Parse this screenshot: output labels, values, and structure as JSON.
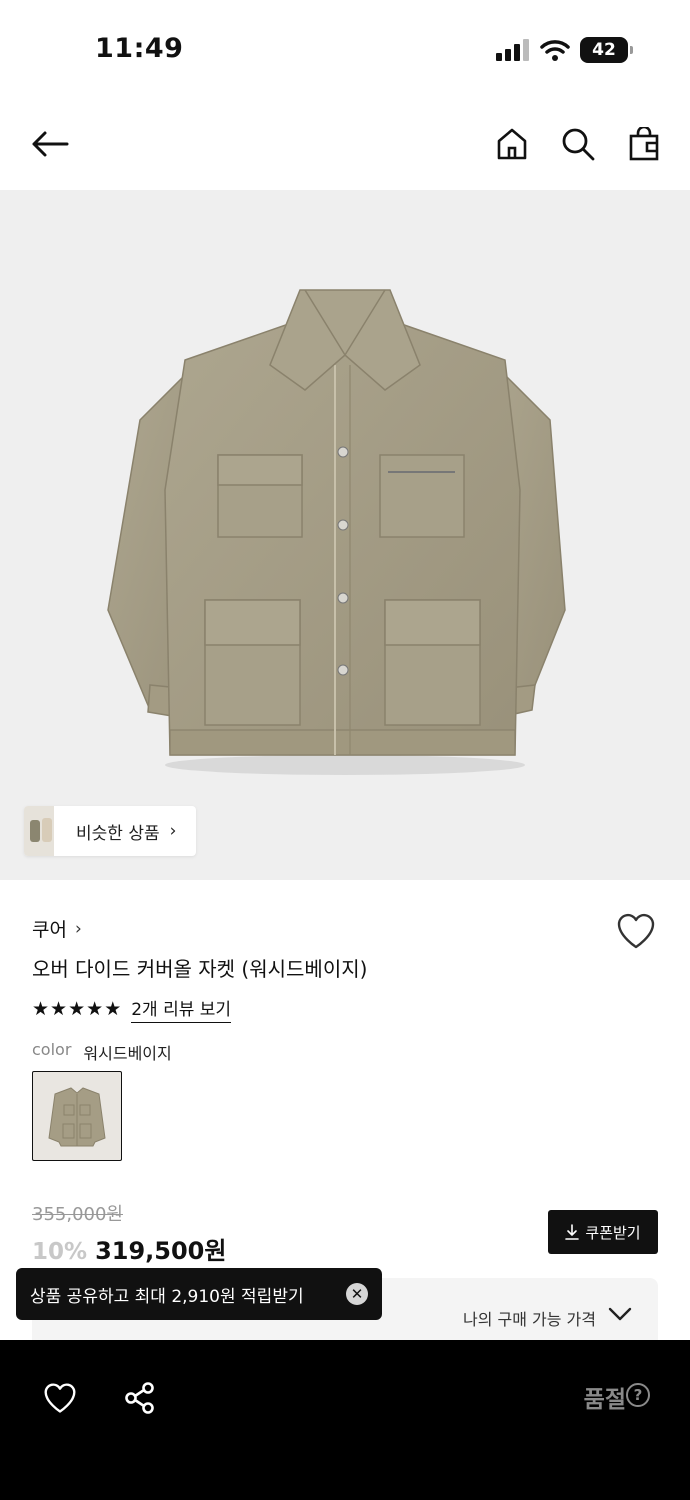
{
  "status_bar": {
    "time": "11:49",
    "battery": "42"
  },
  "icons": {
    "back": "arrow-left-icon",
    "home": "home-icon",
    "search": "search-icon",
    "bag": "shopping-bag-icon",
    "wishlist": "heart-icon",
    "share": "share-icon",
    "coupon": "download-icon",
    "expand": "chevron-down-icon",
    "close": "close-icon",
    "help": "question-icon"
  },
  "hero": {
    "similar_label": "비슷한 상품",
    "similar_chevron": "›"
  },
  "product": {
    "brand": "쿠어",
    "brand_chevron": "›",
    "name": "오버 다이드 커버올 자켓 (워시드베이지)",
    "rating_stars": 5,
    "review_link": "2개 리뷰 보기",
    "color_label": "color",
    "color_value": "워시드베이지"
  },
  "price": {
    "original": "355,000원",
    "discount": "10%",
    "sale": "319,500원",
    "coupon_button": "쿠폰받기",
    "my_price_label": "나의 구매 가능 가격"
  },
  "toast": {
    "message": "상품 공유하고 최대 2,910원 적립받기"
  },
  "bottom_bar": {
    "status": "품절",
    "help_glyph": "?"
  },
  "colors": {
    "background": "#ffffff",
    "hero_bg": "#efefef",
    "jacket": "#a59d85",
    "bar": "#000000",
    "muted": "#8a8a8a"
  }
}
